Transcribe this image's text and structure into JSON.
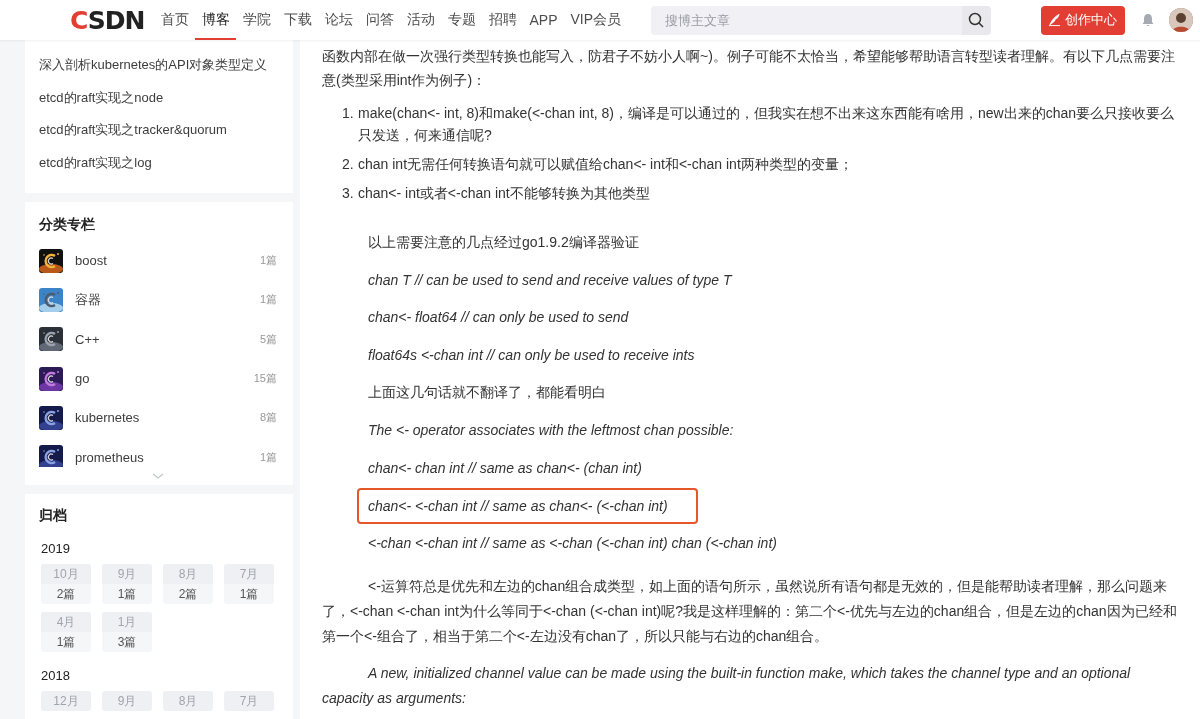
{
  "header": {
    "logo": "CSDN",
    "nav": [
      {
        "label": "首页",
        "selected": false
      },
      {
        "label": "博客",
        "selected": true
      },
      {
        "label": "学院",
        "selected": false
      },
      {
        "label": "下载",
        "selected": false
      },
      {
        "label": "论坛",
        "selected": false
      },
      {
        "label": "问答",
        "selected": false
      },
      {
        "label": "活动",
        "selected": false
      },
      {
        "label": "专题",
        "selected": false
      },
      {
        "label": "招聘",
        "selected": false
      },
      {
        "label": "APP",
        "selected": false
      },
      {
        "label": "VIP会员",
        "selected": false
      }
    ],
    "search": {
      "placeholder": "搜博主文章"
    },
    "create_button": "创作中心"
  },
  "sidebar": {
    "recent_articles": [
      "深入剖析kubernetes的API对象类型定义",
      "etcd的raft实现之node",
      "etcd的raft实现之tracker&quorum",
      "etcd的raft实现之log"
    ],
    "categories": {
      "title": "分类专栏",
      "items": [
        {
          "name": "boost",
          "count": "1篇"
        },
        {
          "name": "容器",
          "count": "1篇"
        },
        {
          "name": "C++",
          "count": "5篇"
        },
        {
          "name": "go",
          "count": "15篇"
        },
        {
          "name": "kubernetes",
          "count": "8篇"
        },
        {
          "name": "prometheus",
          "count": "1篇"
        }
      ]
    },
    "archive": {
      "title": "归档",
      "years": [
        {
          "year": "2019",
          "months": [
            {
              "month": "10月",
              "count": "2篇"
            },
            {
              "month": "9月",
              "count": "1篇"
            },
            {
              "month": "8月",
              "count": "2篇"
            },
            {
              "month": "7月",
              "count": "1篇"
            },
            {
              "month": "4月",
              "count": "1篇"
            },
            {
              "month": "1月",
              "count": "3篇"
            }
          ]
        },
        {
          "year": "2018",
          "months": [
            {
              "month": "12月"
            },
            {
              "month": "9月"
            },
            {
              "month": "8月"
            },
            {
              "month": "7月"
            }
          ]
        }
      ]
    }
  },
  "article": {
    "blocks": [
      {
        "kind": "paragraph",
        "text": "函数内部在做一次强行类型转换也能写入，防君子不妨小人啊~)。例子可能不太恰当，希望能够帮助语言转型读者理解。有以下几点需要注意(类型采用int作为例子)："
      },
      {
        "kind": "list",
        "items": [
          {
            "marker": "1.",
            "text": "make(chan<- int, 8)和make(<-chan int, 8)，编译是可以通过的，但我实在想不出来这东西能有啥用，new出来的chan要么只接收要么只发送，何来通信呢?"
          },
          {
            "marker": "2.",
            "text": "chan int无需任何转换语句就可以赋值给chan<- int和<-chan int两种类型的变量；"
          },
          {
            "marker": "3.",
            "text": "chan<- int或者<-chan int不能够转换为其他类型"
          }
        ]
      },
      {
        "kind": "line",
        "text": "以上需要注意的几点经过go1.9.2编译器验证"
      },
      {
        "kind": "code-line",
        "text": "chan T // can be used to send and receive values of type T",
        "highlighted": false
      },
      {
        "kind": "code-line",
        "text": "chan<- float64 // can only be used to send",
        "highlighted": false
      },
      {
        "kind": "code-line",
        "text": "float64s <-chan int // can only be used to receive ints",
        "highlighted": false
      },
      {
        "kind": "line",
        "text": "上面这几句话就不翻译了，都能看明白"
      },
      {
        "kind": "code-line",
        "text": "The <- operator associates with the leftmost chan possible:",
        "highlighted": false
      },
      {
        "kind": "code-line",
        "text": "chan<- chan int // same as chan<- (chan int)",
        "highlighted": false
      },
      {
        "kind": "code-line",
        "text": "chan<- <-chan int // same as chan<- (<-chan int)",
        "highlighted": true
      },
      {
        "kind": "code-line",
        "text": "<-chan <-chan int // same as <-chan (<-chan int) chan (<-chan int)",
        "highlighted": false
      },
      {
        "kind": "paragraph-indented",
        "text": "<-运算符总是优先和左边的chan组合成类型，如上面的语句所示，虽然说所有语句都是无效的，但是能帮助读者理解，那么问题来了，<-chan <-chan int为什么等同于<-chan (<-chan int)呢?我是这样理解的：第二个<-优先与左边的chan组合，但是左边的chan因为已经和第一个<-组合了，相当于第二个<-左边没有chan了，所以只能与右边的chan组合。"
      },
      {
        "kind": "italic-indented",
        "text": "A new, initialized channel value can be made using the built-in function make, which takes the channel type and an optional capacity as arguments:"
      }
    ]
  }
}
